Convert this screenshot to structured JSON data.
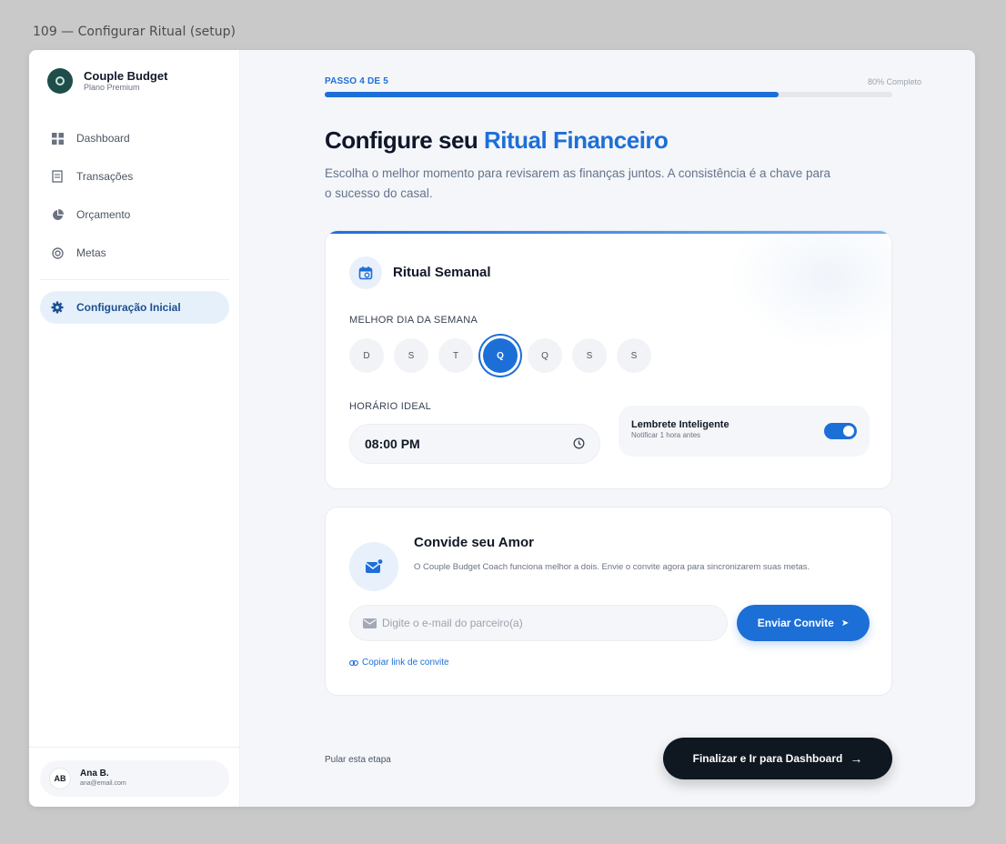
{
  "frame": {
    "label": "109 — Configurar Ritual (setup)"
  },
  "brand": {
    "name": "Couple Budget",
    "plan": "Plano Premium"
  },
  "sidebar": {
    "items": [
      {
        "label": "Dashboard",
        "icon": "dashboard-grid-icon"
      },
      {
        "label": "Transações",
        "icon": "receipt-icon"
      },
      {
        "label": "Orçamento",
        "icon": "pie-chart-icon"
      },
      {
        "label": "Metas",
        "icon": "target-icon"
      }
    ],
    "active_item": {
      "label": "Configuração Inicial",
      "icon": "gear-icon"
    }
  },
  "user": {
    "initials": "AB",
    "name": "Ana B.",
    "email": "ana@email.com"
  },
  "progress": {
    "step_label": "PASSO 4 DE 5",
    "percent_text": "80% Completo",
    "fraction": 0.8
  },
  "header": {
    "title_prefix": "Configure seu ",
    "title_accent": "Ritual Financeiro",
    "subtitle": "Escolha o melhor momento para revisarem as finanças juntos. A consistência é a chave para o sucesso do casal."
  },
  "ritual": {
    "title": "Ritual Semanal",
    "day_label": "MELHOR DIA DA SEMANA",
    "days": [
      "D",
      "S",
      "T",
      "Q",
      "Q",
      "S",
      "S"
    ],
    "selected_day_index": 3,
    "time_label": "HORÁRIO IDEAL",
    "time_value": "08:00 PM",
    "reminder_title": "Lembrete Inteligente",
    "reminder_sub": "Notificar 1 hora antes",
    "reminder_on": true
  },
  "invite": {
    "title": "Convide seu Amor",
    "description": "O Couple Budget Coach funciona melhor a dois. Envie o convite agora para sincronizarem suas metas.",
    "email_placeholder": "Digite o e-mail do parceiro(a)",
    "send_label": "Enviar Convite",
    "copy_link_label": "Copiar link de convite"
  },
  "footer": {
    "skip_label": "Pular esta etapa",
    "finish_label": "Finalizar e Ir para Dashboard"
  },
  "colors": {
    "accent": "#1d6fd8",
    "dark_button": "#0f1720",
    "brand_logo": "#1f4e4a"
  }
}
